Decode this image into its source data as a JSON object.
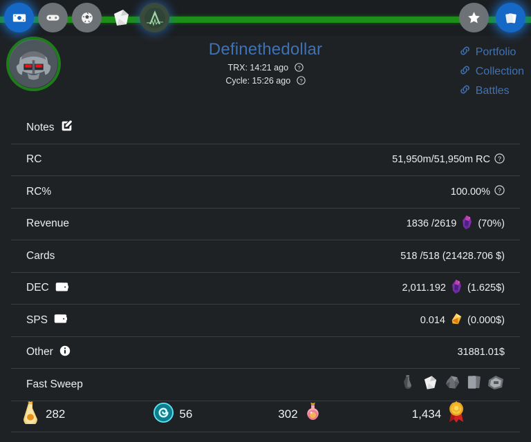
{
  "topnav": {
    "left_items": [
      {
        "name": "money-icon",
        "label": "Market",
        "active": true
      },
      {
        "name": "gamepad-icon",
        "label": "Battle",
        "active": false
      },
      {
        "name": "soccer-ball-icon",
        "label": "Tournaments",
        "active": false
      },
      {
        "name": "scroll-icon",
        "label": "Quests",
        "active": false
      },
      {
        "name": "arcane-a-icon",
        "label": "Arcane",
        "active": false
      }
    ],
    "right_items": [
      {
        "name": "star-icon",
        "label": "Favorites",
        "active": false
      },
      {
        "name": "cards-icon",
        "label": "Cards",
        "active": true
      }
    ]
  },
  "header": {
    "username": "Definethedollar",
    "avatar_name": "mech-robot-avatar",
    "trx_label": "TRX: 14:21 ago",
    "cycle_label": "Cycle: 15:26 ago",
    "links": [
      {
        "label": "Portfolio"
      },
      {
        "label": "Collection"
      },
      {
        "label": "Battles"
      }
    ]
  },
  "rows": [
    {
      "label": "Notes",
      "icon": "edit-pencil-icon",
      "value": ""
    },
    {
      "label": "RC",
      "icon": "",
      "value": "51,950m/51,950m RC",
      "help": true
    },
    {
      "label": "RC%",
      "icon": "",
      "value": "100.00%",
      "help": true
    },
    {
      "label": "Revenue",
      "icon": "",
      "value": "1836 /2619",
      "token": "dec-token-icon",
      "suffix": "(70%)"
    },
    {
      "label": "Cards",
      "icon": "",
      "value": "518 /518 (21428.706 $)"
    },
    {
      "label": "DEC",
      "icon": "wallet-icon",
      "value": "2,011.192",
      "token": "dec-token-icon",
      "suffix": "(1.625$)"
    },
    {
      "label": "SPS",
      "icon": "wallet-icon",
      "value": "0.014",
      "token": "sps-token-icon",
      "suffix": "(0.000$)"
    },
    {
      "label": "Other",
      "icon": "info-icon",
      "value": "31881.01$"
    },
    {
      "label": "Fast Sweep",
      "icon": "",
      "value": "",
      "sweep_icons": [
        "potion-grey-icon",
        "scroll-grey-icon",
        "ore-grey-icon",
        "card-grey-icon",
        "chest-grey-icon"
      ]
    }
  ],
  "bottom_stats": [
    {
      "icon": "gold-potion-icon",
      "value": "282",
      "order": "icon-first"
    },
    {
      "icon": "cyan-vortex-icon",
      "value": "56",
      "order": "icon-first"
    },
    {
      "icon": "pink-potion-icon",
      "value": "302",
      "order": "value-first"
    },
    {
      "icon": "gold-medal-icon",
      "value": "1,434",
      "order": "value-first"
    }
  ],
  "colors": {
    "background": "#1f2225",
    "topbar_green": "#1d8f19",
    "accent_blue": "#3f72b5",
    "active_nav": "#1668c6",
    "divider": "#3b3f43",
    "avatar_ring": "#1d7d18"
  }
}
